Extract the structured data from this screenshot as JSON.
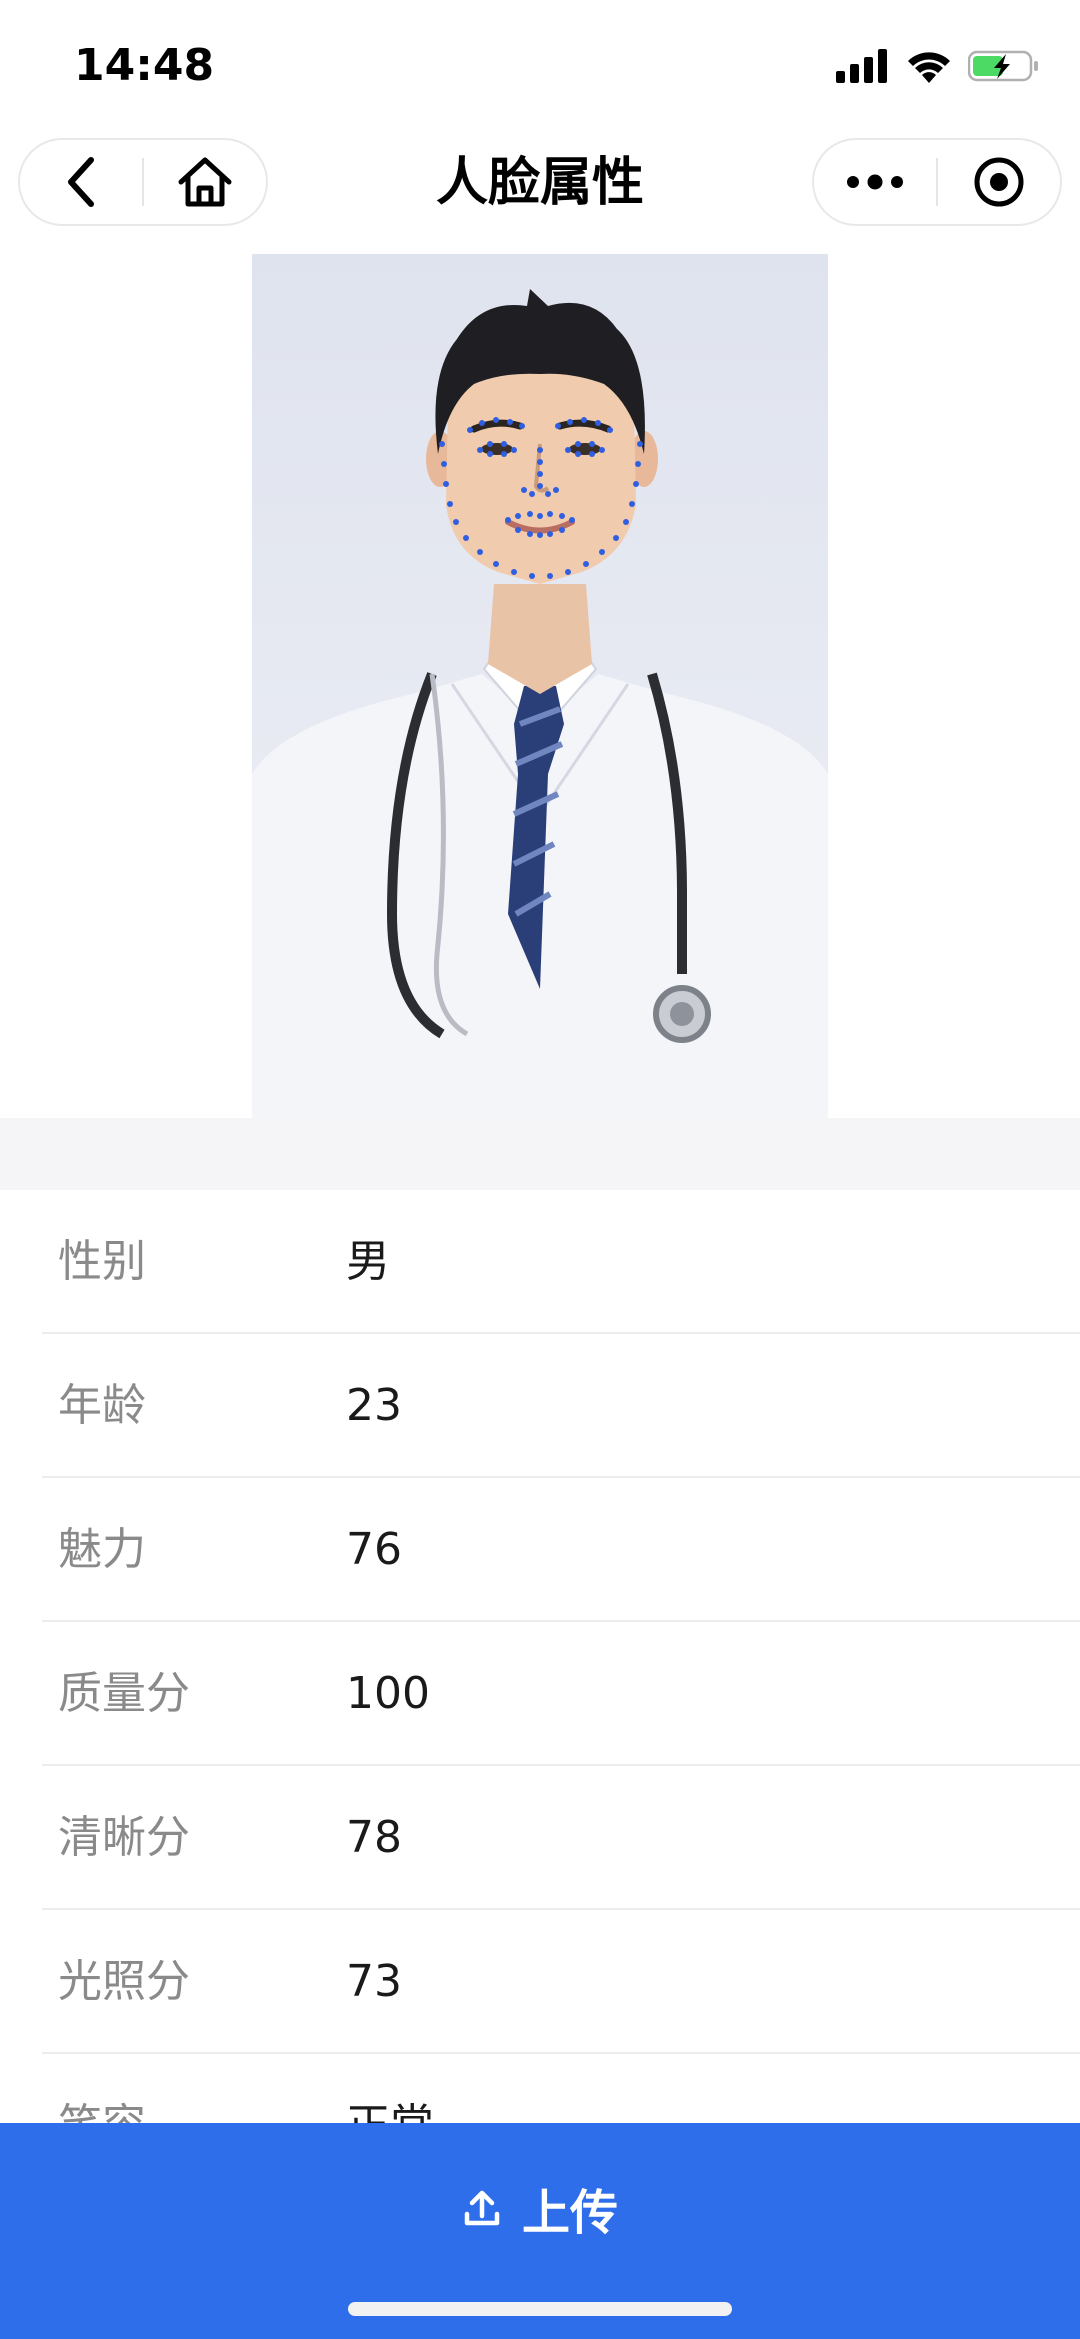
{
  "status_bar": {
    "time": "14:48"
  },
  "nav": {
    "title": "人脸属性",
    "back_icon": "chevron-left-icon",
    "home_icon": "home-icon",
    "more_icon": "more-dots-icon",
    "target_icon": "target-icon"
  },
  "attributes": [
    {
      "label": "性别",
      "value": "男"
    },
    {
      "label": "年龄",
      "value": "23"
    },
    {
      "label": "魅力",
      "value": "76"
    },
    {
      "label": "质量分",
      "value": "100"
    },
    {
      "label": "清晰分",
      "value": "78"
    },
    {
      "label": "光照分",
      "value": "73"
    },
    {
      "label": "笑容",
      "value": "正常"
    }
  ],
  "upload": {
    "label": "上传",
    "icon": "upload-icon"
  },
  "colors": {
    "accent": "#2e6eea",
    "landmark": "#2f5fe0"
  }
}
